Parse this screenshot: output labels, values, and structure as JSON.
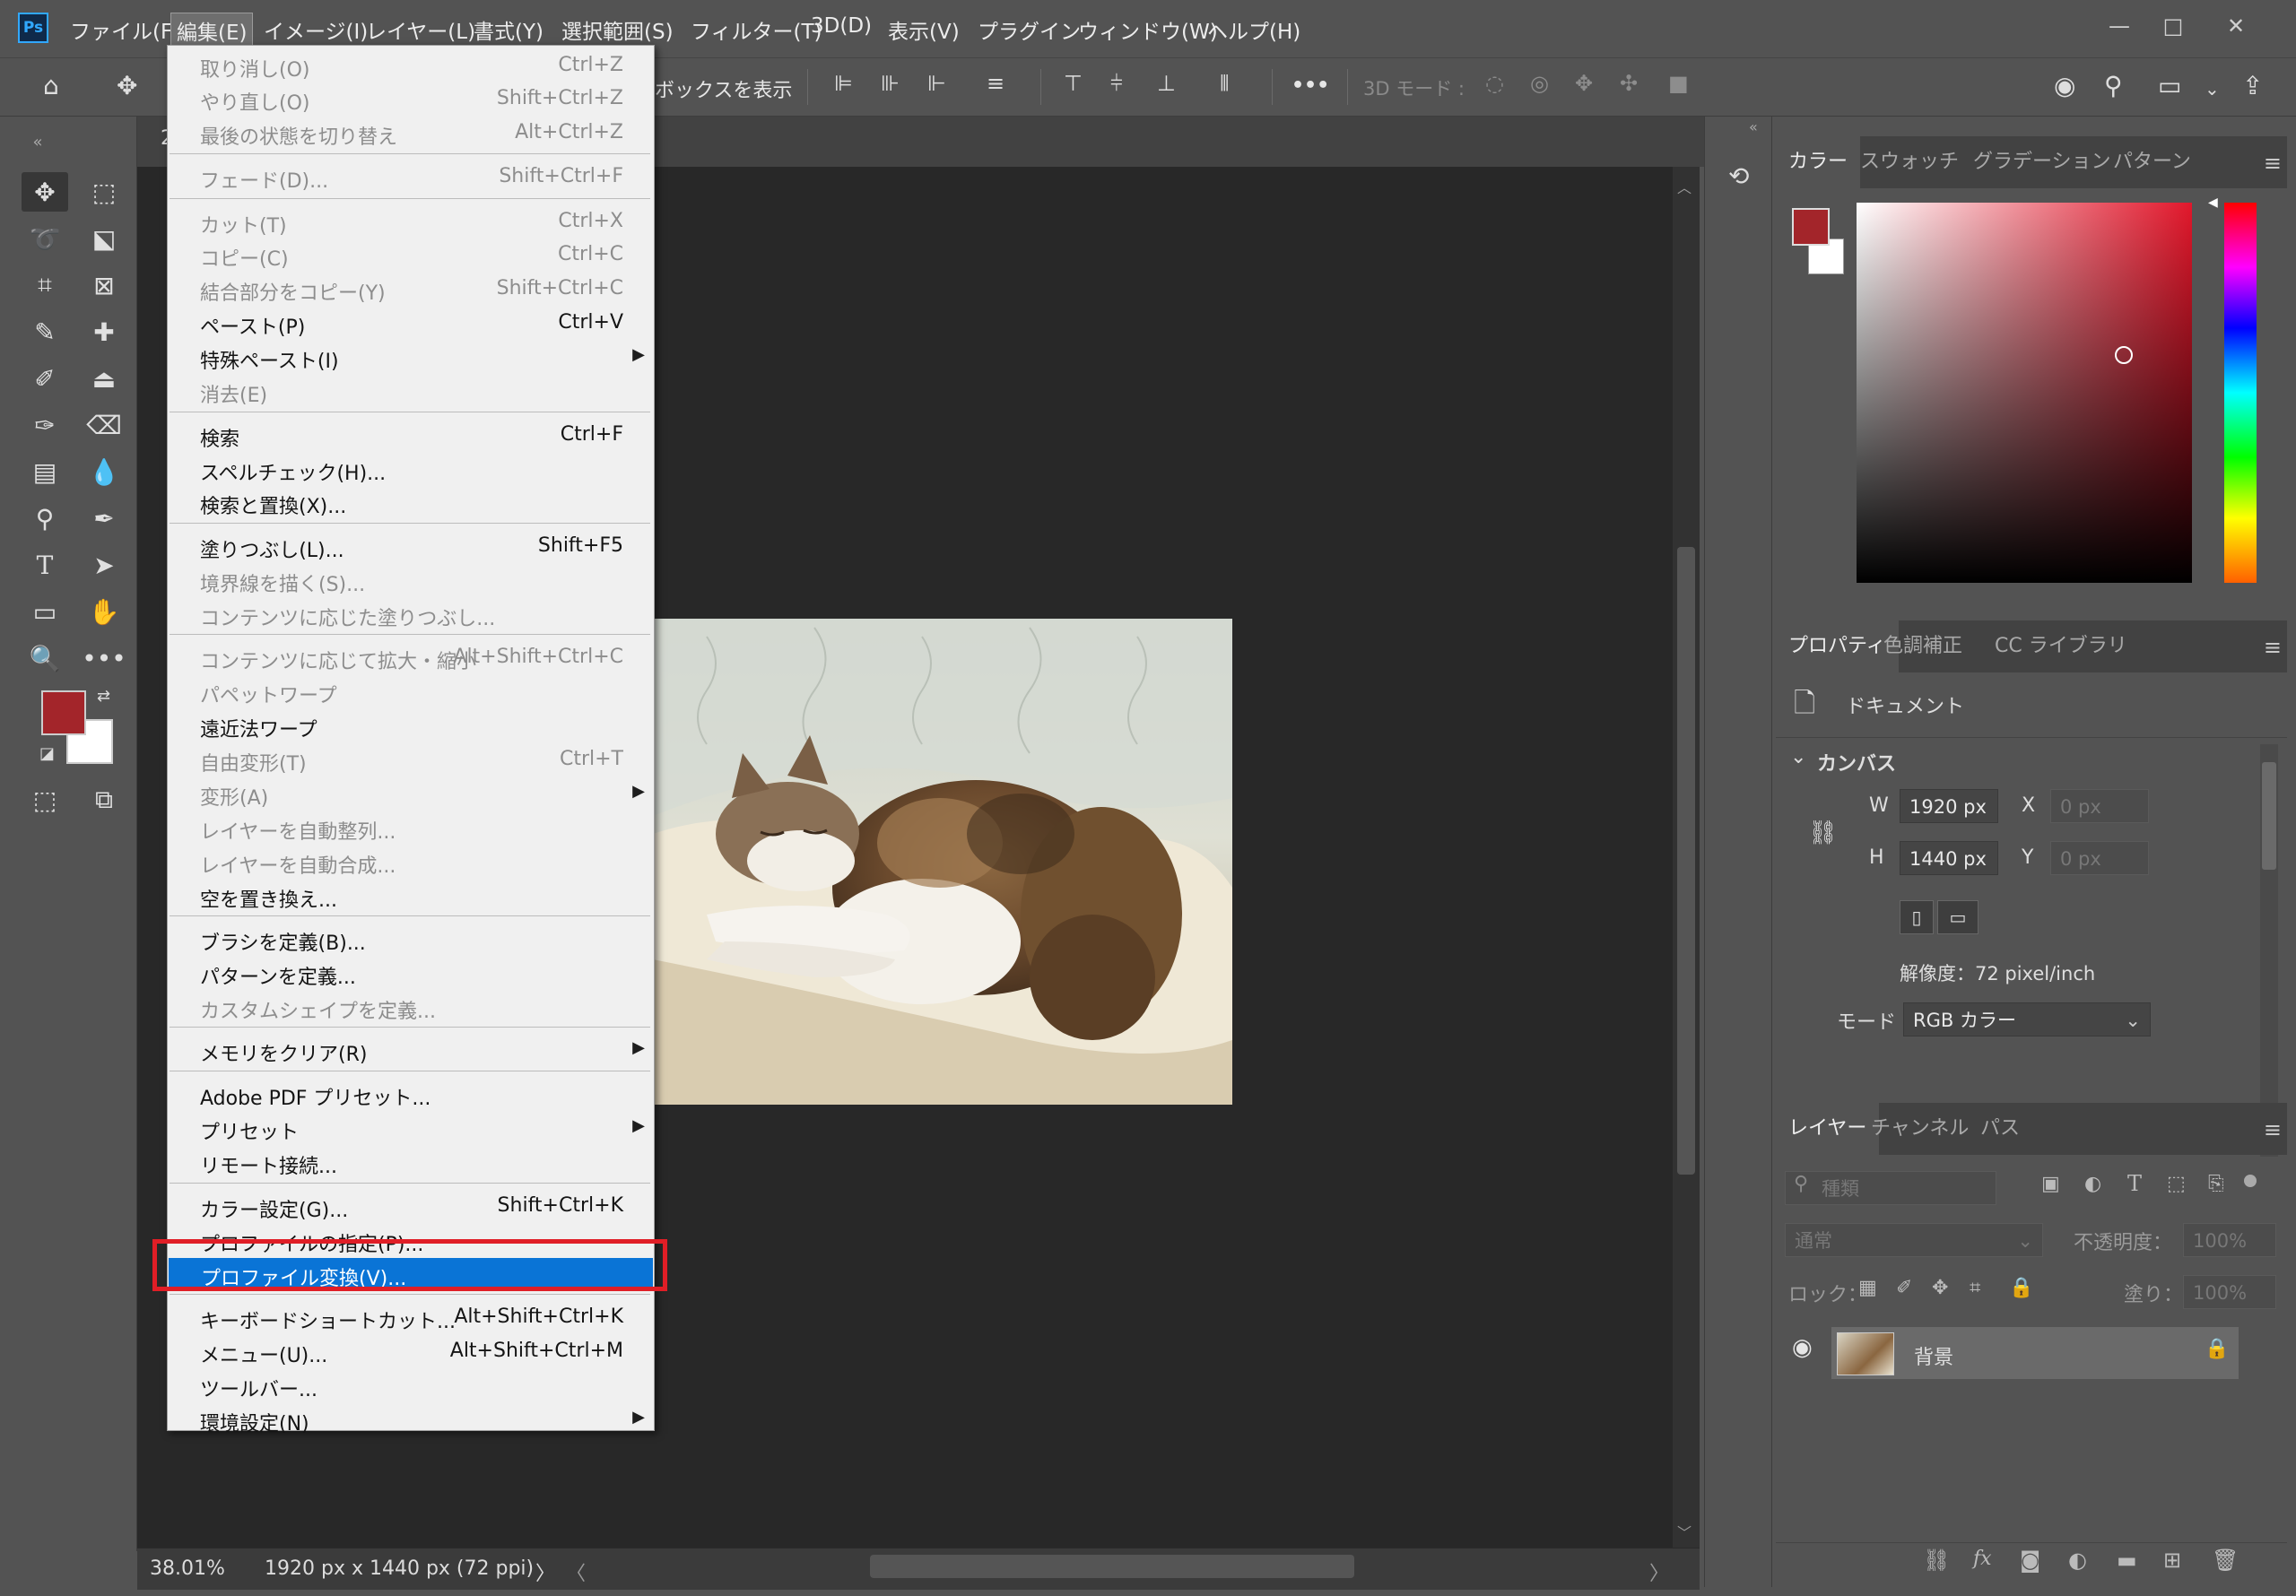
{
  "app": {
    "logo": "Ps"
  },
  "menubar": [
    {
      "label": "ファイル(F)"
    },
    {
      "label": "編集(E)"
    },
    {
      "label": "イメージ(I)"
    },
    {
      "label": "レイヤー(L)"
    },
    {
      "label": "書式(Y)"
    },
    {
      "label": "選択範囲(S)"
    },
    {
      "label": "フィルター(T)"
    },
    {
      "label": "3D(D)"
    },
    {
      "label": "表示(V)"
    },
    {
      "label": "プラグイン"
    },
    {
      "label": "ウィンドウ(W)"
    },
    {
      "label": "ヘルプ(H)"
    }
  ],
  "window_controls": {
    "minimize": "—",
    "maximize": "□",
    "close": "✕"
  },
  "options_bar": {
    "show_transform": "ボックスを表示",
    "more": "•••",
    "mode_3d": "3D モード :"
  },
  "edit_menu": [
    {
      "label": "取り消し(O)",
      "shortcut": "Ctrl+Z",
      "disabled": true
    },
    {
      "label": "やり直し(O)",
      "shortcut": "Shift+Ctrl+Z",
      "disabled": true
    },
    {
      "label": "最後の状態を切り替え",
      "shortcut": "Alt+Ctrl+Z",
      "disabled": true
    },
    {
      "label": "フェード(D)...",
      "shortcut": "Shift+Ctrl+F",
      "disabled": true
    },
    {
      "label": "カット(T)",
      "shortcut": "Ctrl+X",
      "disabled": true
    },
    {
      "label": "コピー(C)",
      "shortcut": "Ctrl+C",
      "disabled": true
    },
    {
      "label": "結合部分をコピー(Y)",
      "shortcut": "Shift+Ctrl+C",
      "disabled": true
    },
    {
      "label": "ペースト(P)",
      "shortcut": "Ctrl+V",
      "disabled": false
    },
    {
      "label": "特殊ペースト(I)",
      "shortcut": "",
      "disabled": false,
      "submenu": true
    },
    {
      "label": "消去(E)",
      "shortcut": "",
      "disabled": true
    },
    {
      "label": "検索",
      "shortcut": "Ctrl+F",
      "disabled": false
    },
    {
      "label": "スペルチェック(H)...",
      "shortcut": "",
      "disabled": false
    },
    {
      "label": "検索と置換(X)...",
      "shortcut": "",
      "disabled": false
    },
    {
      "label": "塗りつぶし(L)...",
      "shortcut": "Shift+F5",
      "disabled": false
    },
    {
      "label": "境界線を描く(S)...",
      "shortcut": "",
      "disabled": true
    },
    {
      "label": "コンテンツに応じた塗りつぶし...",
      "shortcut": "",
      "disabled": true
    },
    {
      "label": "コンテンツに応じて拡大・縮小",
      "shortcut": "Alt+Shift+Ctrl+C",
      "disabled": true
    },
    {
      "label": "パペットワープ",
      "shortcut": "",
      "disabled": true
    },
    {
      "label": "遠近法ワープ",
      "shortcut": "",
      "disabled": false
    },
    {
      "label": "自由変形(T)",
      "shortcut": "Ctrl+T",
      "disabled": true
    },
    {
      "label": "変形(A)",
      "shortcut": "",
      "disabled": true,
      "submenu": true
    },
    {
      "label": "レイヤーを自動整列...",
      "shortcut": "",
      "disabled": true
    },
    {
      "label": "レイヤーを自動合成...",
      "shortcut": "",
      "disabled": true
    },
    {
      "label": "空を置き換え...",
      "shortcut": "",
      "disabled": false
    },
    {
      "label": "ブラシを定義(B)...",
      "shortcut": "",
      "disabled": false
    },
    {
      "label": "パターンを定義...",
      "shortcut": "",
      "disabled": false
    },
    {
      "label": "カスタムシェイプを定義...",
      "shortcut": "",
      "disabled": true
    },
    {
      "label": "メモリをクリア(R)",
      "shortcut": "",
      "disabled": false,
      "submenu": true
    },
    {
      "label": "Adobe PDF プリセット...",
      "shortcut": "",
      "disabled": false
    },
    {
      "label": "プリセット",
      "shortcut": "",
      "disabled": false,
      "submenu": true
    },
    {
      "label": "リモート接続...",
      "shortcut": "",
      "disabled": false
    },
    {
      "label": "カラー設定(G)...",
      "shortcut": "Shift+Ctrl+K",
      "disabled": false
    },
    {
      "label": "プロファイルの指定(P)...",
      "shortcut": "",
      "disabled": false
    },
    {
      "label": "プロファイル変換(V)...",
      "shortcut": "",
      "disabled": false,
      "highlighted": true
    },
    {
      "label": "キーボードショートカット...",
      "shortcut": "Alt+Shift+Ctrl+K",
      "disabled": false
    },
    {
      "label": "メニュー(U)...",
      "shortcut": "Alt+Shift+Ctrl+M",
      "disabled": false
    },
    {
      "label": "ツールバー...",
      "shortcut": "",
      "disabled": false
    },
    {
      "label": "環境設定(N)",
      "shortcut": "",
      "disabled": false,
      "submenu": true
    }
  ],
  "document": {
    "tab_fragment": "2"
  },
  "status": {
    "zoom": "38.01%",
    "doc_info": "1920 px x 1440 px (72 ppi)",
    "arrow": "〉",
    "scroll_left": "〈",
    "scroll_right": "〉"
  },
  "color_panel": {
    "tabs": [
      "カラー",
      "スウォッチ",
      "グラデーション",
      "パターン"
    ],
    "foreground": "#a3252a",
    "background": "#ffffff"
  },
  "properties_panel": {
    "tabs": [
      "プロパティ",
      "色調補正",
      "CC ライブラリ"
    ],
    "doc_label": "ドキュメント",
    "section": "カンバス",
    "w_label": "W",
    "w_value": "1920 px",
    "h_label": "H",
    "h_value": "1440 px",
    "x_label": "X",
    "x_value": "0 px",
    "y_label": "Y",
    "y_value": "0 px",
    "resolution": "解像度：72 pixel/inch",
    "mode_label": "モード",
    "mode_value": "RGB カラー"
  },
  "layers_panel": {
    "tabs": [
      "レイヤー",
      "チャンネル",
      "パス"
    ],
    "filter_placeholder": "種類",
    "blend_mode": "通常",
    "opacity_label": "不透明度：",
    "opacity_value": "100%",
    "lock_label": "ロック：",
    "fill_label": "塗り：",
    "fill_value": "100%",
    "layer_name": "背景"
  },
  "colors": {
    "menu_highlight": "#0a74d6",
    "annotation_box": "#e01e26",
    "foreground_swatch": "#a3252a"
  }
}
